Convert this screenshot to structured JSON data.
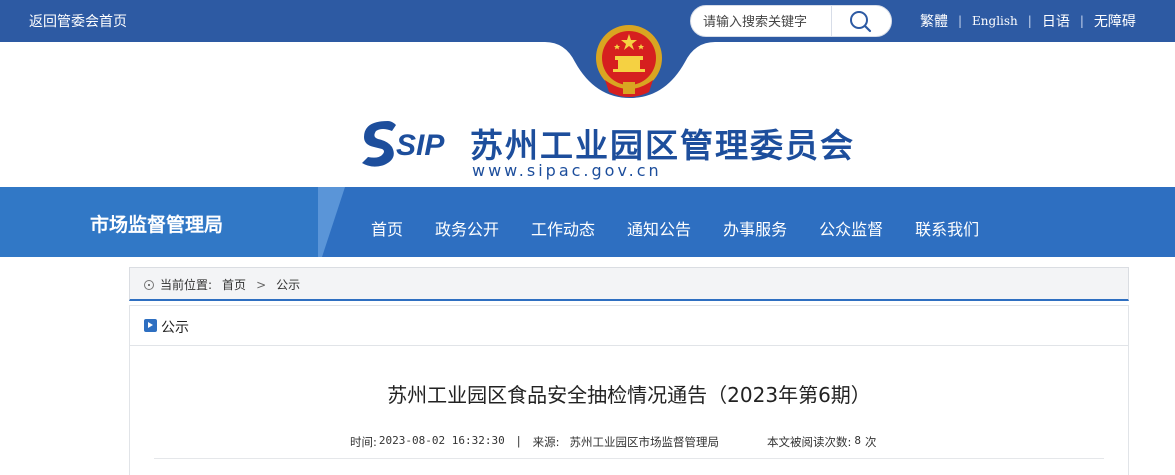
{
  "topbar": {
    "back_label": "返回管委会首页",
    "search_placeholder": "请输入搜索关键字",
    "langs": [
      "繁體",
      "English",
      "日语",
      "无障碍"
    ]
  },
  "header": {
    "logo_text": "SIP",
    "title": "苏州工业园区管理委员会",
    "url": "www.sipac.gov.cn"
  },
  "nav": {
    "dept": "市场监督管理局",
    "items": [
      "首页",
      "政务公开",
      "工作动态",
      "通知公告",
      "办事服务",
      "公众监督",
      "联系我们"
    ]
  },
  "breadcrumb": {
    "label": "当前位置:",
    "home": "首页",
    "current": "公示"
  },
  "panel": {
    "title": "公示",
    "article_title": "苏州工业园区食品安全抽检情况通告（2023年第6期）",
    "time_label": "时间:",
    "time_value": "2023-08-02 16:32:30",
    "source_label": "来源:",
    "source_value": "苏州工业园区市场监督管理局",
    "views_label": "本文被阅读次数:",
    "views_value": "8",
    "views_unit": "次"
  },
  "colors": {
    "topbar": "#2d5aa3",
    "nav": "#2e6fc1",
    "title": "#1d4e9c"
  }
}
